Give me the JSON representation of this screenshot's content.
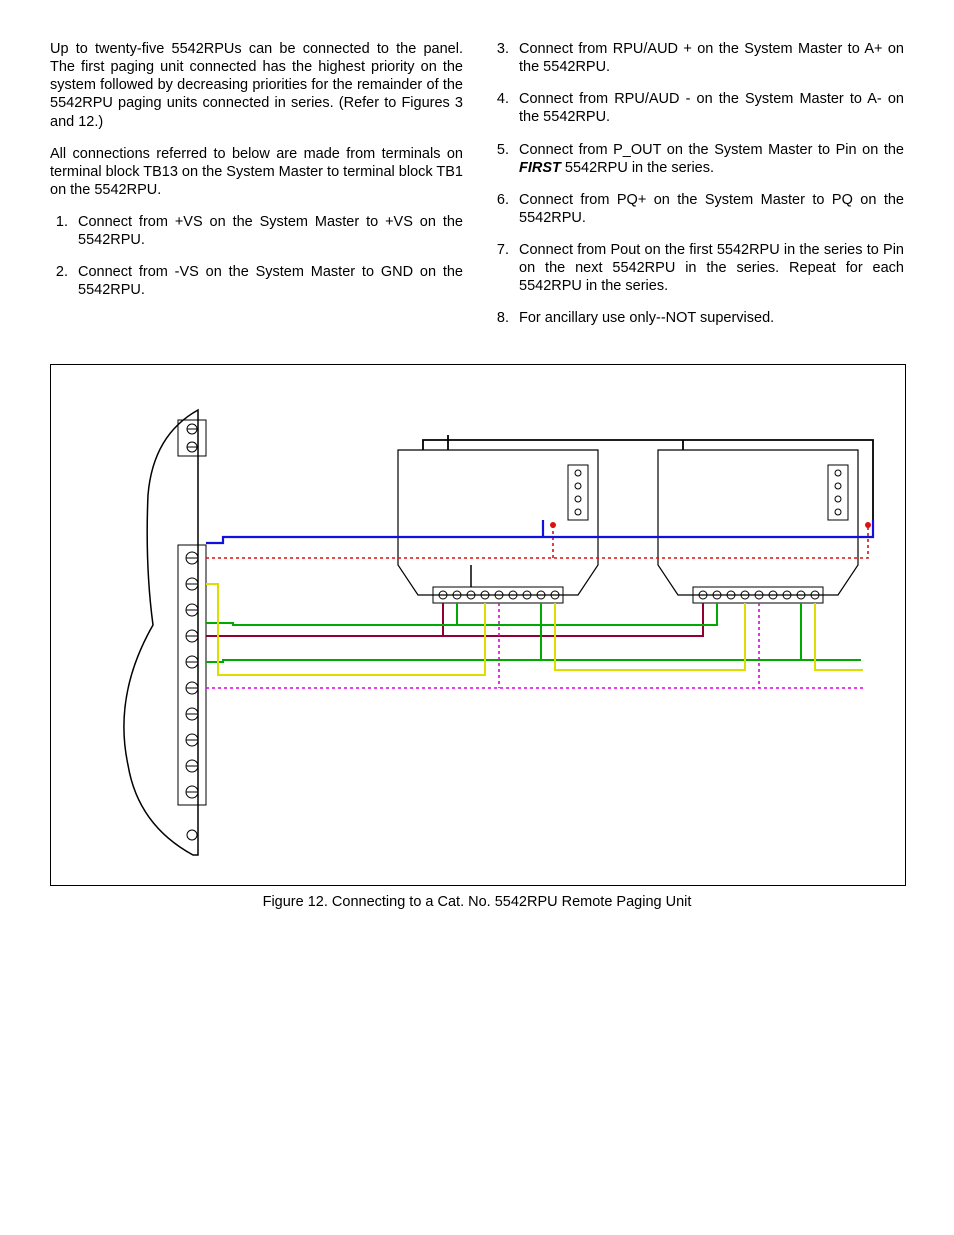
{
  "left": {
    "p1": "Up to twenty-five 5542RPUs can be connected to the panel.  The first paging unit connected has the highest priority on the system followed by decreasing priorities for the remainder of the 5542RPU paging units connected in series.  (Refer to Figures 3 and 12.)",
    "p2": "All connections referred to below are made from terminals on terminal block TB13 on the System Master to terminal block TB1 on the 5542RPU.",
    "li1": "Connect from +VS on the System Master to +VS on the 5542RPU.",
    "li2": "Connect from -VS on the System Master to GND on the 5542RPU."
  },
  "right": {
    "li3": "Connect from RPU/AUD + on the System Master to A+ on the 5542RPU.",
    "li4": "Connect from RPU/AUD - on the System Master to A- on the 5542RPU.",
    "li5a": "Connect from P_OUT on the System Master to Pin on the ",
    "li5_first": "FIRST",
    "li5b": " 5542RPU in the series.",
    "li6": "Connect from PQ+ on the System Master to PQ on the 5542RPU.",
    "li7": "Connect from Pout on the first 5542RPU in the series to Pin on the next 5542RPU in the series.  Repeat for each 5542RPU in the series.",
    "li8": "For ancillary use only--NOT supervised."
  },
  "figure_caption": "Figure 12.  Connecting to a Cat. No. 5542RPU Remote Paging Unit"
}
